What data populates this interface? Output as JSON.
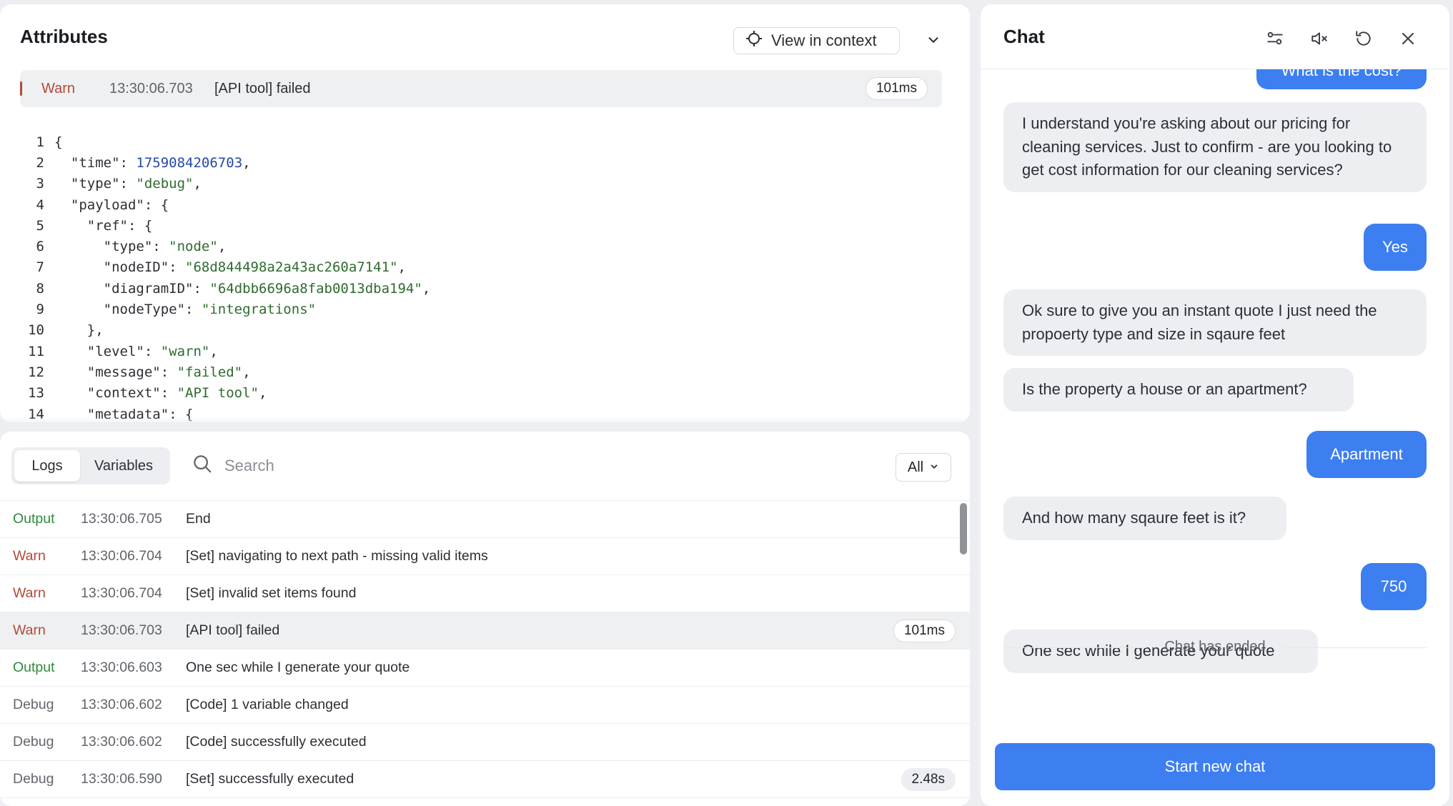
{
  "attributes": {
    "title": "Attributes",
    "view_in_context": "View in context",
    "selected": {
      "level": "Warn",
      "time": "13:30:06.703",
      "message": "[API tool] failed",
      "duration": "101ms"
    },
    "code_lines": [
      {
        "n": "1",
        "text": "{"
      },
      {
        "n": "2",
        "text": "  \"time\": 1759084206703,"
      },
      {
        "n": "3",
        "text": "  \"type\": \"debug\","
      },
      {
        "n": "4",
        "text": "  \"payload\": {"
      },
      {
        "n": "5",
        "text": "    \"ref\": {"
      },
      {
        "n": "6",
        "text": "      \"type\": \"node\","
      },
      {
        "n": "7",
        "text": "      \"nodeID\": \"68d844498a2a43ac260a7141\","
      },
      {
        "n": "8",
        "text": "      \"diagramID\": \"64dbb6696a8fab0013dba194\","
      },
      {
        "n": "9",
        "text": "      \"nodeType\": \"integrations\""
      },
      {
        "n": "10",
        "text": "    },"
      },
      {
        "n": "11",
        "text": "    \"level\": \"warn\","
      },
      {
        "n": "12",
        "text": "    \"message\": \"failed\","
      },
      {
        "n": "13",
        "text": "    \"context\": \"API tool\","
      },
      {
        "n": "14",
        "text": "    \"metadata\": {"
      }
    ]
  },
  "logs": {
    "tabs": [
      {
        "label": "Logs",
        "active": true
      },
      {
        "label": "Variables",
        "active": false
      }
    ],
    "search_placeholder": "Search",
    "filter_label": "All",
    "rows": [
      {
        "level": "Output",
        "time": "13:30:06.705",
        "message": "End",
        "duration": ""
      },
      {
        "level": "Warn",
        "time": "13:30:06.704",
        "message": "[Set] navigating to next path - missing valid items",
        "duration": ""
      },
      {
        "level": "Warn",
        "time": "13:30:06.704",
        "message": "[Set] invalid set items found",
        "duration": ""
      },
      {
        "level": "Warn",
        "time": "13:30:06.703",
        "message": "[API tool] failed",
        "duration": "101ms",
        "selected": true
      },
      {
        "level": "Output",
        "time": "13:30:06.603",
        "message": "One sec while I generate your quote",
        "duration": ""
      },
      {
        "level": "Debug",
        "time": "13:30:06.602",
        "message": "[Code] 1 variable changed",
        "duration": ""
      },
      {
        "level": "Debug",
        "time": "13:30:06.602",
        "message": "[Code] successfully executed",
        "duration": ""
      },
      {
        "level": "Debug",
        "time": "13:30:06.590",
        "message": "[Set] successfully executed",
        "duration": "2.48s"
      }
    ]
  },
  "chat": {
    "title": "Chat",
    "messages": [
      {
        "role": "user",
        "text": "What is the cost?"
      },
      {
        "role": "bot",
        "text": "I understand you're asking about our pricing for cleaning services. Just to confirm - are you looking to get cost information for our cleaning services?"
      },
      {
        "role": "user",
        "text": "Yes"
      },
      {
        "role": "bot",
        "text": "Ok sure to give you an instant quote I just need the propoerty type and size in sqaure feet"
      },
      {
        "role": "bot",
        "text": "Is the property a house or an apartment?"
      },
      {
        "role": "user",
        "text": "Apartment"
      },
      {
        "role": "bot",
        "text": "And how many sqaure feet is it?"
      },
      {
        "role": "user",
        "text": "750"
      },
      {
        "role": "bot",
        "text": "One sec while I generate your quote"
      }
    ],
    "ended_label": "Chat has ended",
    "start_button": "Start new chat"
  }
}
